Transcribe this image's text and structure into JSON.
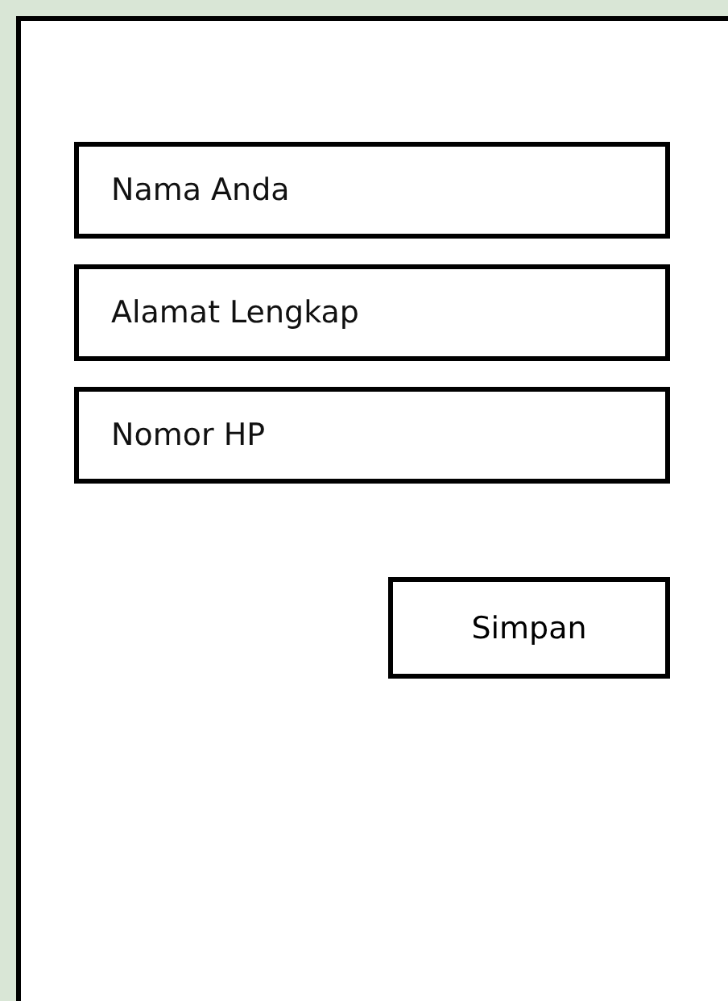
{
  "form": {
    "fields": [
      {
        "placeholder": "Nama Anda"
      },
      {
        "placeholder": "Alamat Lengkap"
      },
      {
        "placeholder": "Nomor HP"
      }
    ],
    "submit_button": "Simpan"
  }
}
